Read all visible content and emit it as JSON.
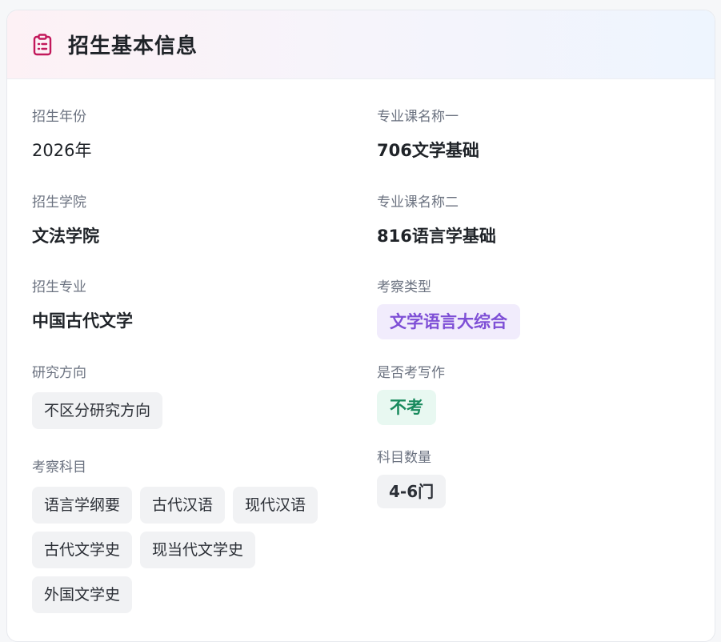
{
  "card": {
    "title": "招生基本信息",
    "icon": "clipboard-list-icon",
    "icon_color": "#c2185b"
  },
  "left": {
    "year": {
      "label": "招生年份",
      "value": "2026年"
    },
    "college": {
      "label": "招生学院",
      "value": "文法学院"
    },
    "major": {
      "label": "招生专业",
      "value": "中国古代文学"
    },
    "direction": {
      "label": "研究方向",
      "value": "不区分研究方向"
    },
    "subjects": {
      "label": "考察科目",
      "items": [
        "语言学纲要",
        "古代汉语",
        "现代汉语",
        "古代文学史",
        "现当代文学史",
        "外国文学史"
      ]
    }
  },
  "right": {
    "course1": {
      "label": "专业课名称一",
      "value": "706文学基础"
    },
    "course2": {
      "label": "专业课名称二",
      "value": "816语言学基础"
    },
    "exam_type": {
      "label": "考察类型",
      "value": "文学语言大综合",
      "color": "#7e4fd6"
    },
    "writing": {
      "label": "是否考写作",
      "value": "不考",
      "color": "#188a5d"
    },
    "subject_count": {
      "label": "科目数量",
      "value": "4-6门"
    }
  }
}
